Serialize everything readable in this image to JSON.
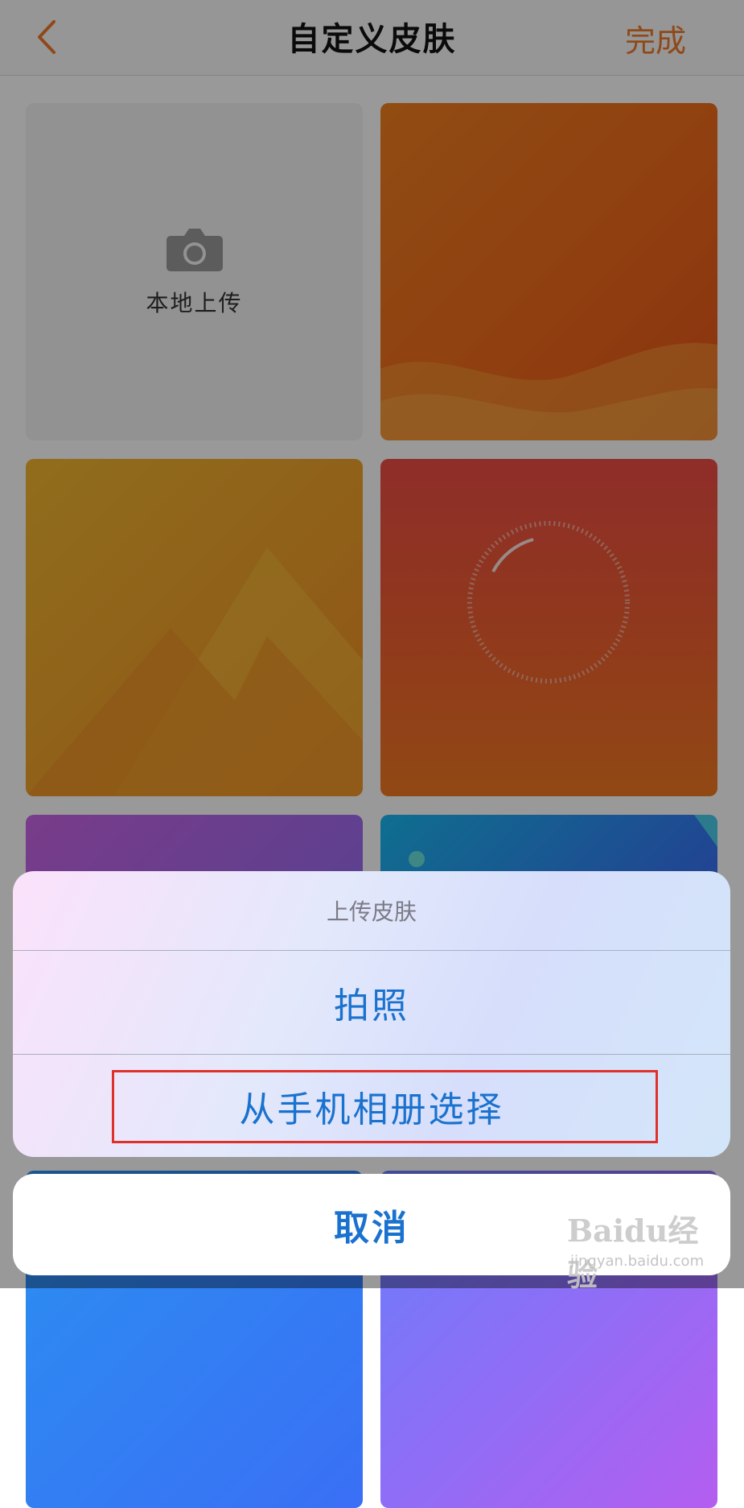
{
  "navbar": {
    "title": "自定义皮肤",
    "done_label": "完成"
  },
  "grid": {
    "upload_tile_label": "本地上传"
  },
  "action_sheet": {
    "title": "上传皮肤",
    "options": [
      {
        "label": "拍照"
      },
      {
        "label": "从手机相册选择"
      }
    ],
    "cancel_label": "取消"
  },
  "watermark": {
    "brand": "Baidu经验",
    "url": "jingyan.baidu.com"
  },
  "colors": {
    "accent": "#ee7a2a",
    "action_blue": "#1a72cf",
    "highlight_red": "#e0302a"
  }
}
